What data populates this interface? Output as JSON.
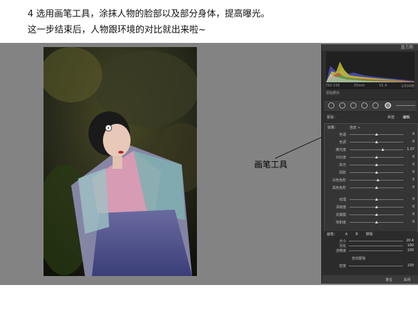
{
  "caption": {
    "line1": "4 选用画笔工具，涂抹人物的脸部以及部分身体，提高曝光。",
    "line2": "这一步结束后，人物跟环境的对比就出来啦~"
  },
  "annotation": {
    "label": "画笔工具"
  },
  "colors": {
    "workspace": "#838383",
    "panel": "#2e2e2e",
    "page": "#ffffff"
  },
  "panel": {
    "header": "直方图",
    "histogram_meta": [
      "ISO 100",
      "35mm",
      "f/1.4",
      "1/500秒"
    ],
    "histogram_check": "原始照片",
    "mask_row": {
      "left": "蒙版：",
      "new": "新建",
      "edit": "编辑"
    },
    "effect_label": "效果：",
    "effect_preset": "自定 ÷",
    "sliders": [
      {
        "label": "色温",
        "value": "0",
        "pos": 0.5
      },
      {
        "label": "色调",
        "value": "0",
        "pos": 0.5
      },
      {
        "label": "曝光度",
        "value": "1.07",
        "pos": 0.62
      },
      {
        "label": "对比度",
        "value": "0",
        "pos": 0.5
      },
      {
        "label": "高光",
        "value": "0",
        "pos": 0.5
      },
      {
        "label": "阴影",
        "value": "0",
        "pos": 0.5
      },
      {
        "label": "白色色阶",
        "value": "5",
        "pos": 0.53
      },
      {
        "label": "黑色色阶",
        "value": "0",
        "pos": 0.5
      },
      {
        "label": "纹理",
        "value": "0",
        "pos": 0.5
      },
      {
        "label": "清晰度",
        "value": "0",
        "pos": 0.5
      },
      {
        "label": "去朦胧",
        "value": "0",
        "pos": 0.5
      },
      {
        "label": "饱和度",
        "value": "0",
        "pos": 0.5
      }
    ],
    "brush": {
      "tabs": [
        "画笔：",
        "A",
        "B",
        "擦除"
      ],
      "rows": [
        {
          "label": "大小",
          "value": "20.4"
        },
        {
          "label": "羽化",
          "value": "100"
        },
        {
          "label": "流畅度",
          "value": "100"
        },
        {
          "label": "密度",
          "value": "100"
        }
      ],
      "auto_mask": "自动蒙版"
    },
    "footer": {
      "reset": "复位",
      "close": "关闭"
    }
  }
}
